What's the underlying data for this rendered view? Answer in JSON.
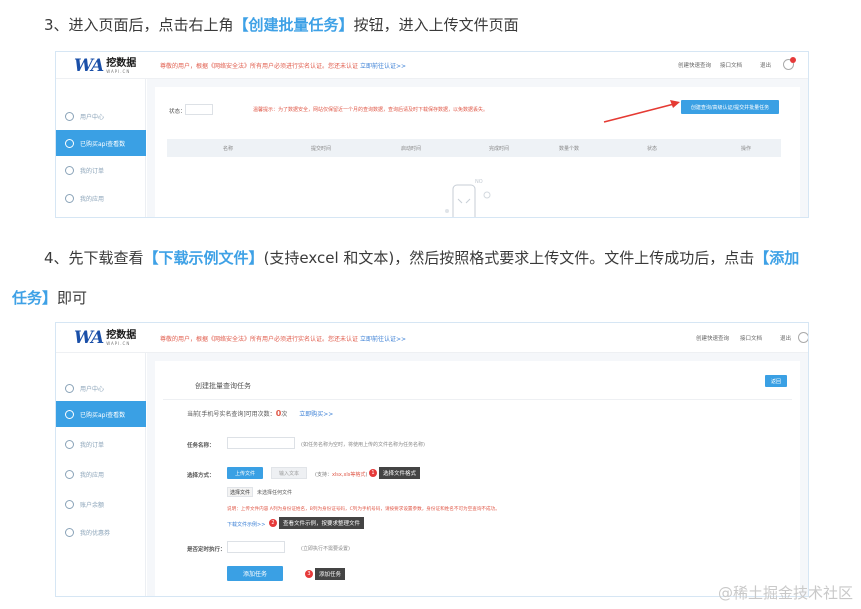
{
  "step3": {
    "prefix": "3、进入页面后，点击右上角",
    "highlight": "【创建批量任务】",
    "suffix": "按钮，进入上传文件页面"
  },
  "step4": {
    "prefix": "4、先下载查看",
    "highlight1": "【下载示例文件】",
    "middle": "(支持excel 和文本)，然后按照格式要求上传文件。文件上传成功后，点击",
    "highlight2": "【添加",
    "line2_highlight": "任务】",
    "line2_suffix": "即可"
  },
  "app": {
    "logo_mark": "WA",
    "logo_cn": "挖数据",
    "logo_en": "WAPI.CN",
    "notice": "尊敬的用户，根据《网络安全法》所有用户必须进行实名认证。您还未认证",
    "notice_link": "立即前往认证>>",
    "nav_query": "创建快速查询",
    "nav_docs": "接口文档",
    "nav_exit": "退出",
    "bell_count": "4"
  },
  "sidebar1": [
    "用户中心",
    "已购买api查看数",
    "我的订单",
    "我的应用"
  ],
  "sidebar2": [
    "用户中心",
    "已购买api查看数",
    "我的订单",
    "我的应用",
    "账户余额",
    "我的优惠券"
  ],
  "shot1": {
    "status_label": "状态：",
    "tip": "温馨提示：为了数据安全，网站仅保留近一个月的查询数据，查询后请及时下载保存数据，以免数据丢失。",
    "create_button": "创建查询/高级认证/提交并批量任务",
    "columns": [
      "名称",
      "提交时间",
      "启动时间",
      "完成时间",
      "数量个数",
      "状态",
      "操作"
    ],
    "empty_label": "NO"
  },
  "shot2": {
    "panel_title": "创建批量查询任务",
    "back_button": "返回",
    "usage_prefix": "当前[手机号实名查询]可用次数：",
    "usage_count": "0",
    "usage_unit": "次",
    "usage_link": "立即购买>>",
    "task_name_label": "任务名称：",
    "task_name_hint": "(如任务名称为空时，将使用上传的文件名称为任务名称)",
    "upload_mode_label": "选择方式：",
    "upload_file_button": "上传文件",
    "input_text_button": "输入文本",
    "support_prefix": "(支持：",
    "support_formats": "xlsx,xls等格式",
    "support_suffix": ")",
    "callout1": "选择文件格式",
    "choose_file_button": "选择文件",
    "no_file_text": "未选择任何文件",
    "desc": "说明：上传文件内容 A列为身份证姓名，B列为身份证号码，C列为手机号码，请按要求设置参数，身份证和姓名不可为空查询不成功。",
    "download_link": "下载文件示例>>",
    "callout2": "查看文件示例，按要求整理文件",
    "schedule_label": "是否定时执行：",
    "schedule_hint": "(立即执行不需要设置)",
    "add_task_button": "添加任务",
    "callout3": "添加任务"
  },
  "watermark": "@稀土掘金技术社区",
  "colors": {
    "accent": "#3aa0e4",
    "highlight": "#3ea1e6",
    "alert": "#e63a3a"
  }
}
